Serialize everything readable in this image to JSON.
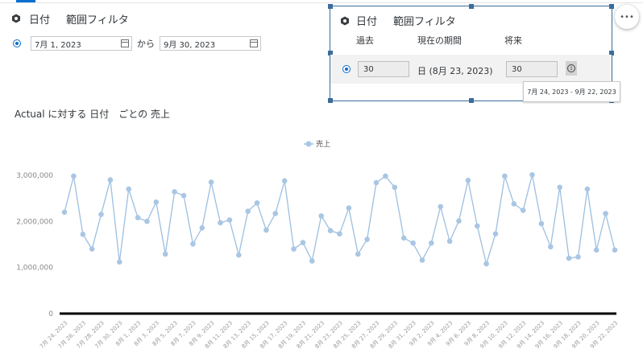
{
  "left_filter": {
    "title_field": "日付",
    "title_type": "範囲フィルタ",
    "from_date": "7月 1, 2023",
    "separator": "から",
    "to_date": "9月 30, 2023"
  },
  "popover": {
    "title_field": "日付",
    "title_type": "範囲フィルタ",
    "col_past": "過去",
    "col_current": "現在の期間",
    "col_future": "将来",
    "past_value": "30",
    "current_value": "日 (8月 23, 2023)",
    "future_value": "30",
    "tooltip_text": "7月 24, 2023 - 9月 22, 2023"
  },
  "more_button": {
    "label": "•••"
  },
  "chart_title": "Actual に対する 日付　ごとの 売上",
  "colors": {
    "series": "#9dbfdf",
    "series_marker": "#a9c6e3",
    "axis": "#000000",
    "accent": "#0a6ed1"
  },
  "chart_data": {
    "type": "line",
    "title": "Actual に対する 日付　ごとの 売上",
    "xlabel": "",
    "ylabel": "",
    "legend": "top-center",
    "ylim": [
      0,
      3000000
    ],
    "yticks": [
      0,
      1000000,
      2000000,
      3000000
    ],
    "ytick_labels": [
      "0",
      "1,000,000",
      "2,000,000",
      "3,000,000"
    ],
    "x_tick_labels": [
      "7月 24, 2023",
      "7月 26, 2023",
      "7月 28, 2023",
      "7月 30, 2023",
      "8月 1, 2023",
      "8月 3, 2023",
      "8月 5, 2023",
      "8月 7, 2023",
      "8月 9, 2023",
      "8月 11, 2023",
      "8月 13, 2023",
      "8月 15, 2023",
      "8月 17, 2023",
      "8月 19, 2023",
      "8月 21, 2023",
      "8月 23, 2023",
      "8月 25, 2023",
      "8月 27, 2023",
      "8月 29, 2023",
      "8月 31, 2023",
      "9月 2, 2023",
      "9月 4, 2023",
      "9月 6, 2023",
      "9月 8, 2023",
      "9月 10, 2023",
      "9月 12, 2023",
      "9月 14, 2023",
      "9月 16, 2023",
      "9月 18, 2023",
      "9月 20, 2023",
      "9月 22, 2023"
    ],
    "series": [
      {
        "name": "売上",
        "values": [
          2200000,
          2980000,
          1720000,
          1400000,
          2150000,
          2900000,
          1120000,
          2700000,
          2080000,
          2000000,
          2420000,
          1290000,
          2640000,
          2560000,
          1510000,
          1860000,
          2850000,
          1970000,
          2030000,
          1270000,
          2220000,
          2400000,
          1810000,
          2170000,
          2880000,
          1400000,
          1540000,
          1140000,
          2120000,
          1800000,
          1730000,
          2290000,
          1290000,
          1610000,
          2840000,
          2980000,
          2740000,
          1640000,
          1530000,
          1160000,
          1530000,
          2320000,
          1570000,
          2010000,
          2890000,
          1900000,
          1080000,
          1730000,
          2980000,
          2380000,
          2240000,
          3010000,
          1950000,
          1450000,
          2740000,
          1200000,
          1230000,
          2700000,
          1380000,
          2170000,
          1380000
        ]
      }
    ]
  }
}
